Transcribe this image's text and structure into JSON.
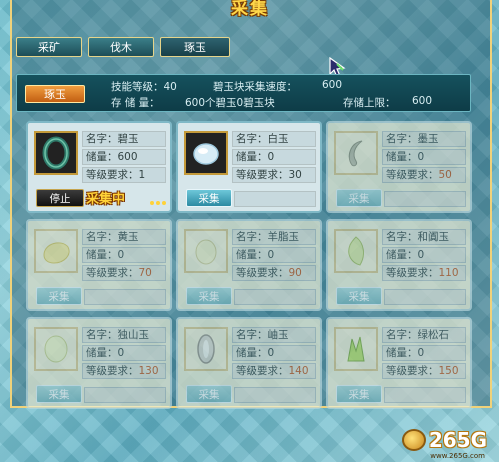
{
  "window": {
    "title": "采集"
  },
  "tabs": [
    {
      "label": "采矿"
    },
    {
      "label": "伐木"
    },
    {
      "label": "琢玉"
    }
  ],
  "info": {
    "badge": "琢玉",
    "skill_level": "技能等级：40",
    "collect_speed": "碧玉块采集速度：",
    "collect_speed_value": "600",
    "storage": "存 储 量：",
    "storage_value": "600个碧玉0碧玉块",
    "storage_limit": "存储上限：",
    "storage_limit_value": "600"
  },
  "items": [
    {
      "name": "名字：碧玉",
      "stock": "储量：600",
      "req": "等级要求：1",
      "button": "停止",
      "status": "采集中",
      "icon": "jade-green-ring-icon"
    },
    {
      "name": "名字：白玉",
      "stock": "储量：0",
      "req": "等级要求：30",
      "button": "采集",
      "icon": "white-jade-icon"
    },
    {
      "name": "名字：墨玉",
      "stock": "储量：0",
      "req_label": "等级要求：",
      "req_value": "50",
      "button": "采集",
      "icon": "ink-jade-icon"
    },
    {
      "name": "名字：黄玉",
      "stock": "储量：0",
      "req_label": "等级要求：",
      "req_value": "70",
      "button": "采集",
      "icon": "yellow-jade-icon"
    },
    {
      "name": "名字：羊脂玉",
      "stock": "储量：0",
      "req_label": "等级要求：",
      "req_value": "90",
      "button": "采集",
      "icon": "mutton-fat-jade-icon"
    },
    {
      "name": "名字：和阗玉",
      "stock": "储量：0",
      "req_label": "等级要求：",
      "req_value": "110",
      "button": "采集",
      "icon": "hetian-jade-icon"
    },
    {
      "name": "名字：独山玉",
      "stock": "储量：0",
      "req_label": "等级要求：",
      "req_value": "130",
      "button": "采集",
      "icon": "dushan-jade-icon"
    },
    {
      "name": "名字：岫玉",
      "stock": "储量：0",
      "req_label": "等级要求：",
      "req_value": "140",
      "button": "采集",
      "icon": "xiu-jade-icon"
    },
    {
      "name": "名字：绿松石",
      "stock": "储量：0",
      "req_label": "等级要求：",
      "req_value": "150",
      "button": "采集",
      "icon": "turquoise-icon"
    }
  ],
  "watermark": {
    "text": "265G",
    "sub": "www.265G.com"
  },
  "colors": {
    "accent_gold": "#ffd84a",
    "panel_teal": "#15515d",
    "requirement_orange": "#c0541c"
  }
}
